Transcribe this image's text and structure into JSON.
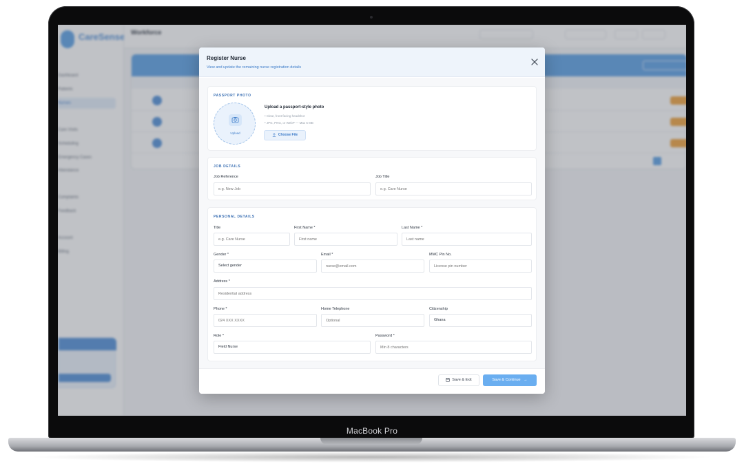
{
  "device": {
    "label": "MacBook Pro"
  },
  "background_app": {
    "brand": "CareSense",
    "page_title": "Workforce",
    "nav_items": [
      "Dashboard",
      "Patients",
      "Nurses",
      "Care Visits",
      "Scheduling",
      "Emergency Cases",
      "Attendance",
      "Complaints",
      "Feedback",
      "Account",
      "Billing"
    ]
  },
  "modal": {
    "title": "Register Nurse",
    "subtitle": "View and update the remaining nurse registration details",
    "passport": {
      "section_title": "PASSPORT PHOTO",
      "upload_label": "Upload",
      "heading": "Upload a passport-style photo",
      "bullet1": "• Clear, front-facing headshot",
      "bullet2": "• JPG, PNG, or WebP — Max 5 MB",
      "choose_label": "Choose File"
    },
    "job": {
      "section_title": "JOB DETAILS",
      "reference_label": "Job Reference",
      "reference_placeholder": "e.g. New Job",
      "title_label": "Job Title",
      "title_placeholder": "e.g. Care Nurse"
    },
    "personal": {
      "section_title": "PERSONAL DETAILS",
      "title_label": "Title",
      "title_placeholder": "e.g. Care Nurse",
      "first_label": "First Name *",
      "first_placeholder": "First name",
      "last_label": "Last Name *",
      "last_placeholder": "Last name",
      "gender_label": "Gender *",
      "gender_value": "Select gender",
      "email_label": "Email *",
      "email_placeholder": "nurse@email.com",
      "mmc_label": "MMC Pin No.",
      "mmc_placeholder": "License pin number",
      "address_label": "Address *",
      "address_placeholder": "Residential address",
      "phone_label": "Phone *",
      "phone_placeholder": "024 XXX XXXX",
      "home_label": "Home Telephone",
      "home_placeholder": "Optional",
      "citizenship_label": "Citizenship",
      "citizenship_value": "Ghana",
      "role_label": "Role *",
      "role_value": "Field Nurse",
      "password_label": "Password *",
      "password_placeholder": "Min 8 characters"
    },
    "footer": {
      "save_exit_label": "Save & Exit",
      "save_continue_label": "Save & Continue"
    }
  },
  "colors": {
    "accent": "#3d7cc9",
    "primary_button": "#6aaef0",
    "header_bg": "#eef4fb"
  }
}
